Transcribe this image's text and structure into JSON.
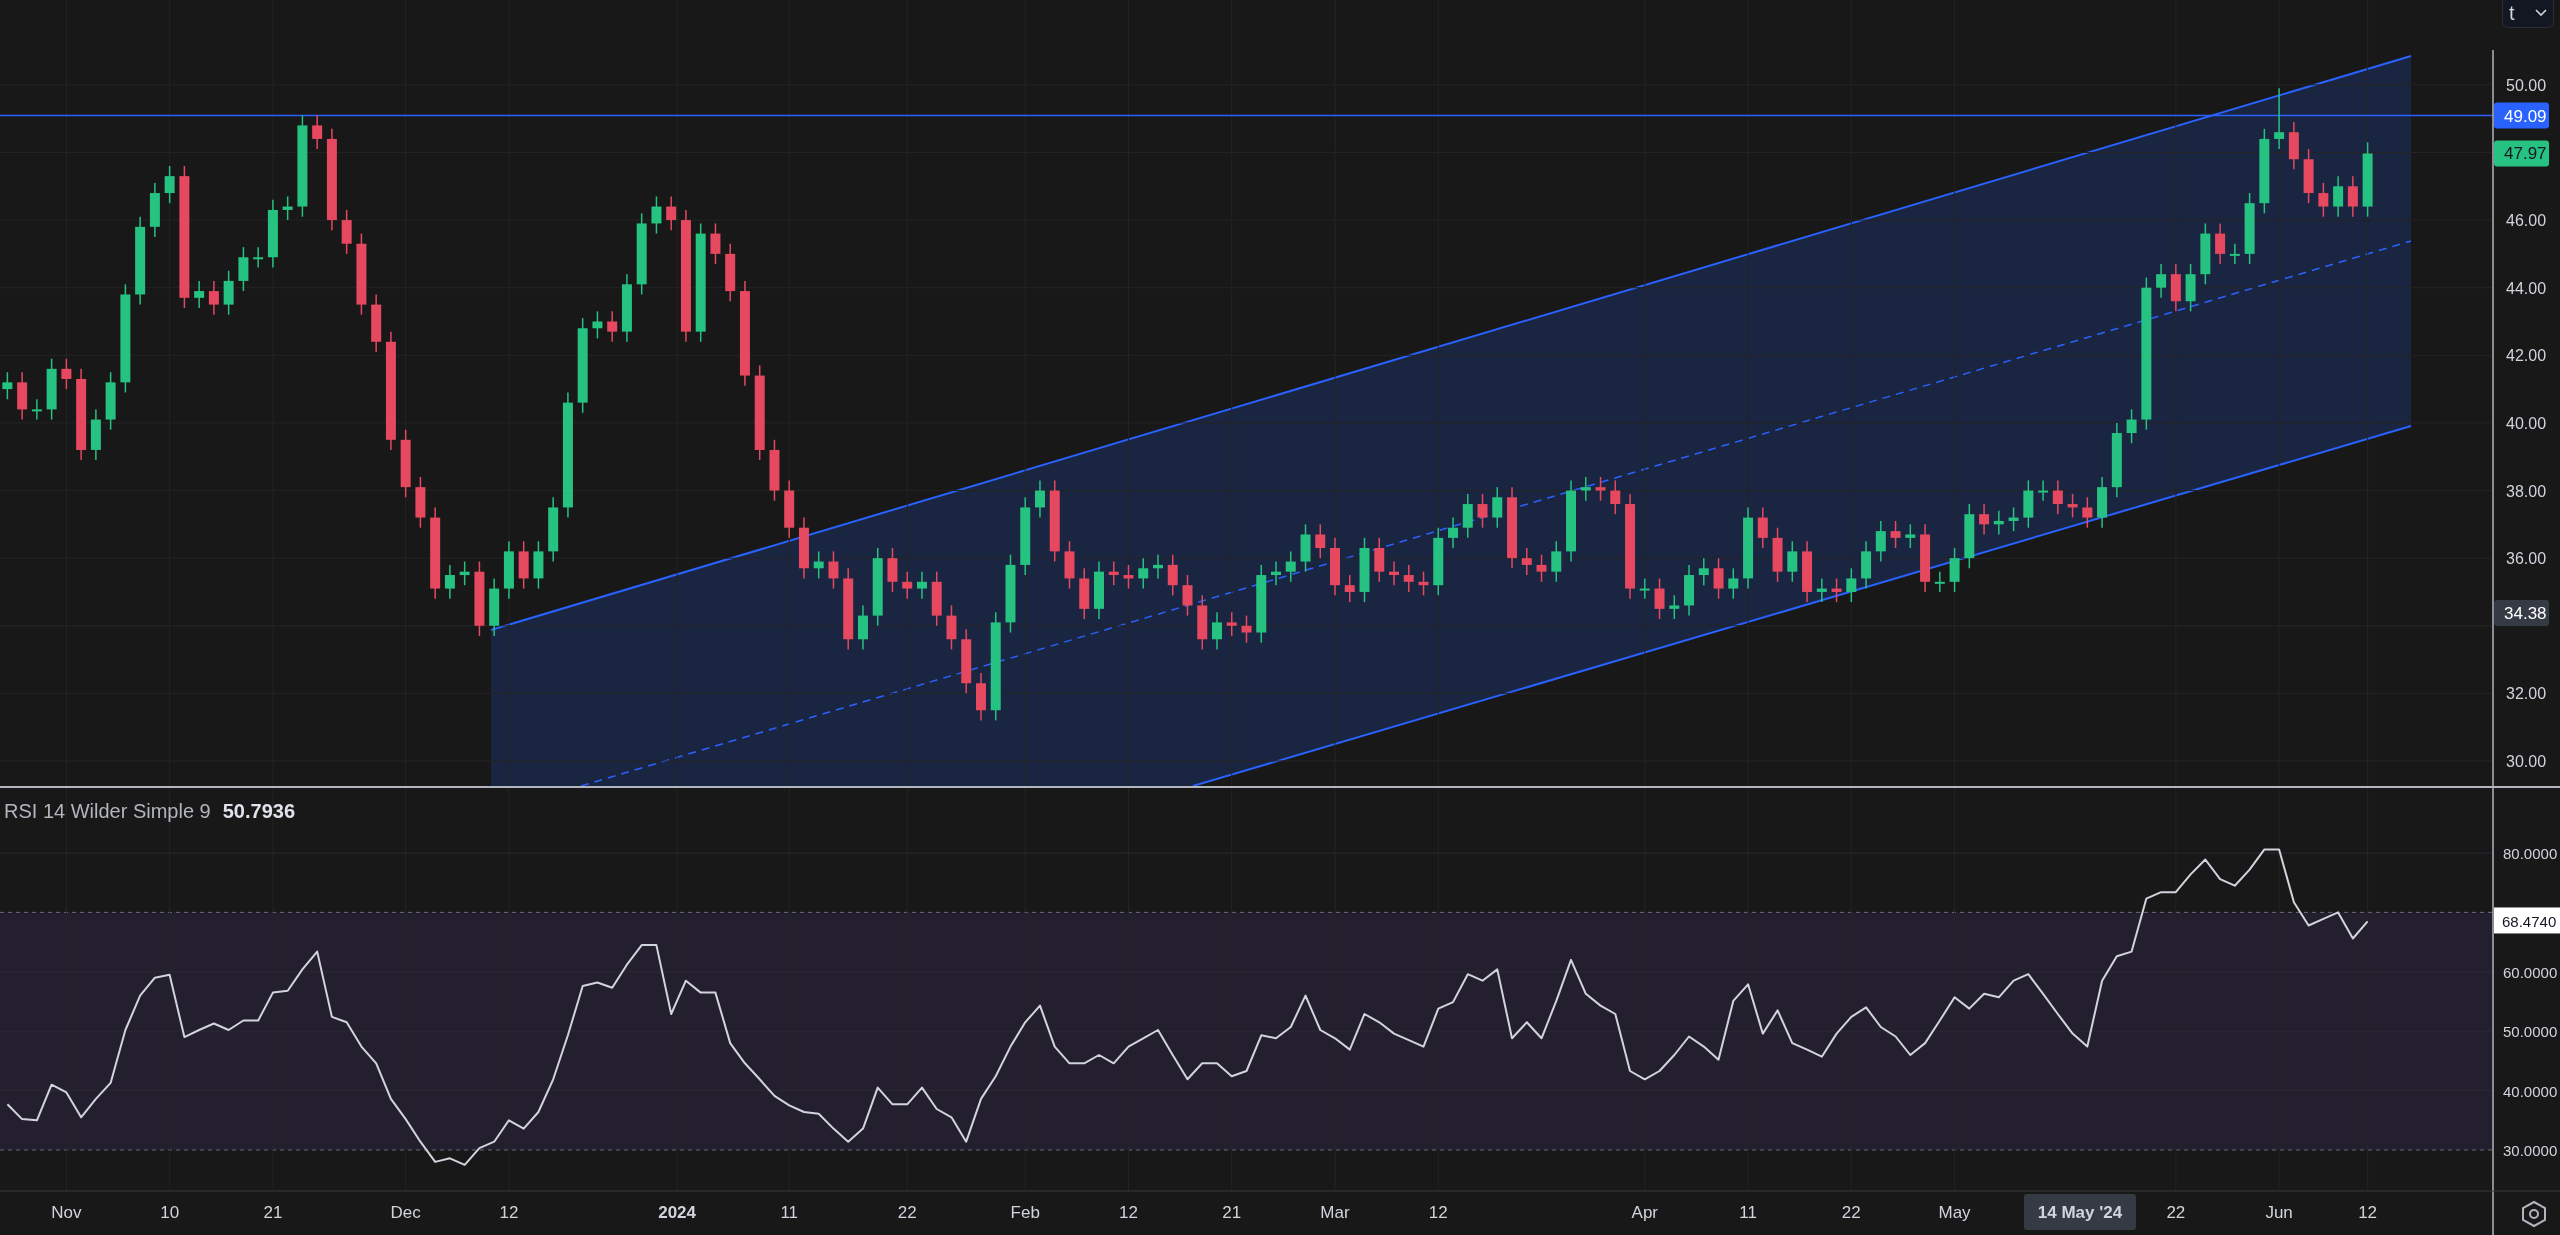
{
  "top_toolbar": {
    "dropdown": {
      "value": "t"
    }
  },
  "price_chart": {
    "chart_data": {
      "type": "candlestick",
      "grid": true,
      "ylim": [
        29.26,
        52.51
      ],
      "categories": [
        null,
        null,
        null,
        null,
        null,
        null,
        null,
        null,
        null,
        null,
        null,
        null,
        null,
        null,
        null,
        null,
        null,
        null,
        null,
        null,
        null,
        null,
        null,
        null,
        null,
        null,
        null,
        null,
        null,
        null,
        null,
        null,
        null,
        null,
        null,
        null,
        null,
        null,
        null,
        null,
        null,
        null,
        null,
        null,
        null,
        null,
        null,
        null,
        null,
        null,
        null,
        null,
        null,
        null,
        null,
        null,
        null,
        null,
        null,
        null,
        null,
        null,
        null,
        null,
        null,
        null,
        null,
        null,
        null,
        null,
        null,
        null,
        null,
        null,
        null,
        null,
        null,
        null,
        null,
        null,
        null,
        null,
        null,
        null,
        null,
        null,
        null,
        null,
        null,
        null,
        null,
        null,
        null,
        null,
        null,
        null,
        null,
        null,
        null,
        null,
        null,
        null,
        null,
        null,
        null,
        null,
        null,
        null,
        null,
        null,
        null,
        null,
        null,
        null,
        null,
        null,
        null,
        null,
        null,
        null,
        null,
        null,
        null,
        null,
        null,
        null,
        null,
        null,
        null,
        null,
        null,
        null,
        null,
        null,
        null,
        null,
        null,
        null,
        null,
        null,
        null,
        null,
        null,
        null,
        null,
        null,
        null,
        null,
        null,
        null,
        null,
        null,
        null,
        null,
        null,
        null,
        null,
        null,
        null,
        null,
        null,
        null,
        null,
        null,
        null,
        null,
        null,
        null,
        null
      ],
      "yticks": [
        {
          "value": 30,
          "label": "30.00"
        },
        {
          "value": 32,
          "label": "32.00"
        },
        {
          "value": 36,
          "label": "36.00"
        },
        {
          "value": 38,
          "label": "38.00"
        },
        {
          "value": 40,
          "label": "40.00"
        },
        {
          "value": 42,
          "label": "42.00"
        },
        {
          "value": 44,
          "label": "44.00"
        },
        {
          "value": 46,
          "label": "46.00"
        },
        {
          "value": 50,
          "label": "50.00"
        }
      ],
      "ohlc": [
        [
          41.0,
          41.5,
          40.7,
          41.2
        ],
        [
          41.2,
          41.5,
          40.1,
          40.4
        ],
        [
          40.4,
          40.7,
          40.1,
          40.4
        ],
        [
          40.4,
          41.9,
          40.1,
          41.6
        ],
        [
          41.6,
          41.9,
          41.0,
          41.3
        ],
        [
          41.3,
          41.6,
          38.9,
          39.2
        ],
        [
          39.2,
          40.4,
          38.9,
          40.1
        ],
        [
          40.1,
          41.5,
          39.8,
          41.2
        ],
        [
          41.2,
          44.1,
          40.9,
          43.8
        ],
        [
          43.8,
          46.1,
          43.5,
          45.8
        ],
        [
          45.8,
          47.1,
          45.5,
          46.8
        ],
        [
          46.8,
          47.6,
          46.5,
          47.3
        ],
        [
          47.3,
          47.6,
          43.4,
          43.7
        ],
        [
          43.7,
          44.2,
          43.4,
          43.9
        ],
        [
          43.9,
          44.2,
          43.2,
          43.5
        ],
        [
          43.5,
          44.5,
          43.2,
          44.2
        ],
        [
          44.2,
          45.2,
          43.9,
          44.9
        ],
        [
          44.9,
          45.2,
          44.6,
          44.9
        ],
        [
          44.9,
          46.6,
          44.6,
          46.3
        ],
        [
          46.3,
          46.7,
          46.0,
          46.4
        ],
        [
          46.4,
          49.1,
          46.1,
          48.8
        ],
        [
          48.8,
          49.1,
          48.1,
          48.4
        ],
        [
          48.4,
          48.7,
          45.7,
          46.0
        ],
        [
          46.0,
          46.3,
          45.0,
          45.3
        ],
        [
          45.3,
          45.6,
          43.2,
          43.5
        ],
        [
          43.5,
          43.8,
          42.1,
          42.4
        ],
        [
          42.4,
          42.7,
          39.2,
          39.5
        ],
        [
          39.5,
          39.8,
          37.8,
          38.1
        ],
        [
          38.1,
          38.4,
          36.9,
          37.2
        ],
        [
          37.2,
          37.5,
          34.8,
          35.1
        ],
        [
          35.1,
          35.8,
          34.8,
          35.5
        ],
        [
          35.5,
          35.9,
          35.2,
          35.6
        ],
        [
          35.6,
          35.9,
          33.7,
          34.0
        ],
        [
          34.0,
          35.4,
          33.7,
          35.1
        ],
        [
          35.1,
          36.5,
          34.8,
          36.2
        ],
        [
          36.2,
          36.5,
          35.1,
          35.4
        ],
        [
          35.4,
          36.5,
          35.1,
          36.2
        ],
        [
          36.2,
          37.8,
          35.9,
          37.5
        ],
        [
          37.5,
          40.9,
          37.2,
          40.6
        ],
        [
          40.6,
          43.1,
          40.3,
          42.8
        ],
        [
          42.8,
          43.3,
          42.5,
          43.0
        ],
        [
          43.0,
          43.3,
          42.4,
          42.7
        ],
        [
          42.7,
          44.4,
          42.4,
          44.1
        ],
        [
          44.1,
          46.2,
          43.8,
          45.9
        ],
        [
          45.9,
          46.7,
          45.6,
          46.4
        ],
        [
          46.4,
          46.7,
          45.7,
          46.0
        ],
        [
          46.0,
          46.3,
          42.4,
          42.7
        ],
        [
          42.7,
          45.9,
          42.4,
          45.6
        ],
        [
          45.6,
          45.9,
          44.7,
          45.0
        ],
        [
          45.0,
          45.3,
          43.6,
          43.9
        ],
        [
          43.9,
          44.2,
          41.1,
          41.4
        ],
        [
          41.4,
          41.7,
          38.9,
          39.2
        ],
        [
          39.2,
          39.5,
          37.7,
          38.0
        ],
        [
          38.0,
          38.3,
          36.6,
          36.9
        ],
        [
          36.9,
          37.2,
          35.4,
          35.7
        ],
        [
          35.7,
          36.2,
          35.4,
          35.9
        ],
        [
          35.9,
          36.2,
          35.1,
          35.4
        ],
        [
          35.4,
          35.7,
          33.3,
          33.6
        ],
        [
          33.6,
          34.6,
          33.3,
          34.3
        ],
        [
          34.3,
          36.3,
          34.0,
          36.0
        ],
        [
          36.0,
          36.3,
          35.0,
          35.3
        ],
        [
          35.3,
          35.6,
          34.8,
          35.1
        ],
        [
          35.1,
          35.6,
          34.8,
          35.3
        ],
        [
          35.3,
          35.6,
          34.0,
          34.3
        ],
        [
          34.3,
          34.6,
          33.3,
          33.6
        ],
        [
          33.6,
          33.9,
          32.0,
          32.3
        ],
        [
          32.3,
          32.6,
          31.2,
          31.5
        ],
        [
          31.5,
          34.4,
          31.2,
          34.1
        ],
        [
          34.1,
          36.1,
          33.8,
          35.8
        ],
        [
          35.8,
          37.8,
          35.5,
          37.5
        ],
        [
          37.5,
          38.3,
          37.2,
          38.0
        ],
        [
          38.0,
          38.3,
          35.9,
          36.2
        ],
        [
          36.2,
          36.5,
          35.1,
          35.4
        ],
        [
          35.4,
          35.7,
          34.2,
          34.5
        ],
        [
          34.5,
          35.9,
          34.2,
          35.6
        ],
        [
          35.6,
          35.9,
          35.2,
          35.5
        ],
        [
          35.5,
          35.8,
          35.1,
          35.4
        ],
        [
          35.4,
          36.0,
          35.1,
          35.7
        ],
        [
          35.7,
          36.1,
          35.4,
          35.8
        ],
        [
          35.8,
          36.1,
          34.9,
          35.2
        ],
        [
          35.2,
          35.5,
          34.3,
          34.6
        ],
        [
          34.6,
          34.9,
          33.3,
          33.6
        ],
        [
          33.6,
          34.4,
          33.3,
          34.1
        ],
        [
          34.1,
          34.4,
          33.7,
          34.0
        ],
        [
          34.0,
          34.3,
          33.5,
          33.8
        ],
        [
          33.8,
          35.8,
          33.5,
          35.5
        ],
        [
          35.5,
          35.9,
          35.2,
          35.6
        ],
        [
          35.6,
          36.2,
          35.3,
          35.9
        ],
        [
          35.9,
          37.0,
          35.6,
          36.7
        ],
        [
          36.7,
          37.0,
          36.0,
          36.3
        ],
        [
          36.3,
          36.6,
          34.9,
          35.2
        ],
        [
          35.2,
          35.5,
          34.7,
          35.0
        ],
        [
          35.0,
          36.6,
          34.7,
          36.3
        ],
        [
          36.3,
          36.6,
          35.3,
          35.6
        ],
        [
          35.6,
          35.9,
          35.2,
          35.5
        ],
        [
          35.5,
          35.8,
          35.0,
          35.3
        ],
        [
          35.3,
          35.6,
          34.9,
          35.2
        ],
        [
          35.2,
          36.9,
          34.9,
          36.6
        ],
        [
          36.6,
          37.2,
          36.3,
          36.9
        ],
        [
          36.9,
          37.9,
          36.6,
          37.6
        ],
        [
          37.6,
          37.9,
          36.9,
          37.2
        ],
        [
          37.2,
          38.1,
          36.9,
          37.8
        ],
        [
          37.8,
          38.1,
          35.7,
          36.0
        ],
        [
          36.0,
          36.3,
          35.5,
          35.8
        ],
        [
          35.8,
          36.1,
          35.3,
          35.6
        ],
        [
          35.6,
          36.5,
          35.3,
          36.2
        ],
        [
          36.2,
          38.3,
          35.9,
          38.0
        ],
        [
          38.0,
          38.4,
          37.7,
          38.1
        ],
        [
          38.1,
          38.4,
          37.7,
          38.0
        ],
        [
          38.0,
          38.3,
          37.3,
          37.6
        ],
        [
          37.6,
          37.9,
          34.8,
          35.1
        ],
        [
          35.1,
          35.4,
          34.8,
          35.1
        ],
        [
          35.1,
          35.4,
          34.2,
          34.5
        ],
        [
          34.5,
          34.9,
          34.2,
          34.6
        ],
        [
          34.6,
          35.8,
          34.3,
          35.5
        ],
        [
          35.5,
          36.0,
          35.2,
          35.7
        ],
        [
          35.7,
          36.0,
          34.8,
          35.1
        ],
        [
          35.1,
          35.7,
          34.8,
          35.4
        ],
        [
          35.4,
          37.5,
          35.1,
          37.2
        ],
        [
          37.2,
          37.5,
          36.3,
          36.6
        ],
        [
          36.6,
          36.9,
          35.3,
          35.6
        ],
        [
          35.6,
          36.5,
          35.3,
          36.2
        ],
        [
          36.2,
          36.5,
          34.7,
          35.0
        ],
        [
          35.0,
          35.4,
          34.7,
          35.1
        ],
        [
          35.1,
          35.4,
          34.7,
          35.0
        ],
        [
          35.0,
          35.7,
          34.7,
          35.4
        ],
        [
          35.4,
          36.5,
          35.1,
          36.2
        ],
        [
          36.2,
          37.1,
          35.9,
          36.8
        ],
        [
          36.8,
          37.1,
          36.3,
          36.6
        ],
        [
          36.6,
          37.0,
          36.3,
          36.7
        ],
        [
          36.7,
          37.0,
          35.0,
          35.3
        ],
        [
          35.3,
          35.6,
          35.0,
          35.3
        ],
        [
          35.3,
          36.3,
          35.0,
          36.0
        ],
        [
          36.0,
          37.6,
          35.7,
          37.3
        ],
        [
          37.3,
          37.6,
          36.7,
          37.0
        ],
        [
          37.0,
          37.4,
          36.7,
          37.1
        ],
        [
          37.1,
          37.5,
          36.8,
          37.2
        ],
        [
          37.2,
          38.3,
          36.9,
          38.0
        ],
        [
          38.0,
          38.3,
          37.7,
          38.0
        ],
        [
          38.0,
          38.3,
          37.3,
          37.6
        ],
        [
          37.6,
          37.9,
          37.2,
          37.5
        ],
        [
          37.5,
          37.8,
          36.9,
          37.2
        ],
        [
          37.2,
          38.4,
          36.9,
          38.1
        ],
        [
          38.1,
          40.0,
          37.8,
          39.7
        ],
        [
          39.7,
          40.4,
          39.4,
          40.1
        ],
        [
          40.1,
          44.3,
          39.8,
          44.0
        ],
        [
          44.0,
          44.7,
          43.7,
          44.4
        ],
        [
          44.4,
          44.7,
          43.3,
          43.6
        ],
        [
          43.6,
          44.7,
          43.3,
          44.4
        ],
        [
          44.4,
          45.9,
          44.1,
          45.6
        ],
        [
          45.6,
          45.9,
          44.7,
          45.0
        ],
        [
          45.0,
          45.3,
          44.7,
          45.0
        ],
        [
          45.0,
          46.8,
          44.7,
          46.5
        ],
        [
          46.5,
          48.7,
          46.2,
          48.4
        ],
        [
          48.4,
          49.9,
          48.1,
          48.6
        ],
        [
          48.6,
          48.9,
          47.5,
          47.8
        ],
        [
          47.8,
          48.1,
          46.5,
          46.8
        ],
        [
          46.8,
          47.1,
          46.1,
          46.4
        ],
        [
          46.4,
          47.3,
          46.1,
          47.0
        ],
        [
          47.0,
          47.3,
          46.1,
          46.4
        ],
        [
          46.4,
          48.3,
          46.1,
          47.97
        ],
        null,
        null,
        null,
        null,
        null,
        null,
        null,
        null
      ],
      "ref_lines": [
        {
          "axis": "y",
          "value": 49.09
        }
      ]
    },
    "price_labels": [
      {
        "text": "49.09",
        "color": "#2962ff"
      },
      {
        "text": "47.97",
        "color": "#26c281"
      },
      {
        "text": "34.38",
        "color": "#363a45"
      }
    ]
  },
  "rsi_panel": {
    "legend": {
      "name": "RSI 14 Wilder Simple 9",
      "value": "50.7936"
    },
    "last_value": "68.4740",
    "chart_data": {
      "type": "line",
      "grid": true,
      "ylim": [
        15.69,
        90.94
      ],
      "yticks": [
        {
          "value": 30,
          "label": "30.0000"
        },
        {
          "value": 40,
          "label": "40.0000"
        },
        {
          "value": 50,
          "label": "50.0000"
        },
        {
          "value": 60,
          "label": "60.0000"
        },
        {
          "value": 80,
          "label": "80.0000"
        }
      ],
      "categories": [
        null,
        null,
        null,
        null,
        "Nov",
        null,
        null,
        null,
        null,
        null,
        null,
        "10",
        null,
        null,
        null,
        null,
        null,
        null,
        "21",
        null,
        null,
        null,
        null,
        null,
        null,
        null,
        null,
        "Dec",
        null,
        null,
        null,
        null,
        null,
        null,
        "12",
        null,
        null,
        null,
        null,
        null,
        null,
        null,
        null,
        null,
        null,
        null,
        null,
        null,
        null,
        null,
        null,
        null,
        null,
        "11",
        null,
        null,
        null,
        null,
        null,
        null,
        null,
        "22",
        null,
        null,
        null,
        null,
        null,
        null,
        null,
        "Feb",
        null,
        null,
        null,
        null,
        null,
        null,
        "12",
        null,
        null,
        null,
        null,
        null,
        null,
        "21",
        null,
        null,
        null,
        null,
        null,
        null,
        "Mar",
        null,
        null,
        null,
        null,
        null,
        null,
        "12",
        null,
        null,
        null,
        null,
        null,
        null,
        null,
        null,
        null,
        null,
        null,
        null,
        null,
        "Apr",
        null,
        null,
        null,
        null,
        null,
        null,
        "11",
        null,
        null,
        null,
        null,
        null,
        null,
        "22",
        null,
        null,
        null,
        null,
        null,
        null,
        "May",
        null,
        null,
        null,
        null,
        null,
        null,
        null,
        null,
        null,
        null,
        null,
        null,
        null,
        null,
        "22",
        null,
        null,
        null,
        null,
        null,
        null,
        "Jun",
        null,
        null,
        null,
        null,
        null,
        "12",
        null,
        null,
        null,
        null,
        null,
        null,
        null,
        null
      ],
      "ref_lines": [
        {
          "axis": "y",
          "value": 70
        },
        {
          "axis": "y",
          "value": 30
        }
      ],
      "series": [
        {
          "color": "#d1d4dc",
          "values": [
            37.7,
            35.2,
            35,
            41,
            39.7,
            35.5,
            38.6,
            41.3,
            50.2,
            56,
            59,
            59.5,
            49,
            50.2,
            51.3,
            50.2,
            51.8,
            51.8,
            56.5,
            56.8,
            60.4,
            63.4,
            52.4,
            51.5,
            47.4,
            44.6,
            38.6,
            35.2,
            31.4,
            28,
            28.6,
            27.5,
            30.3,
            31.4,
            35,
            33.6,
            36.4,
            41.9,
            49.3,
            57.6,
            58.2,
            57.3,
            61.2,
            64.5,
            64.5,
            52.9,
            58.5,
            56.5,
            56.5,
            48,
            44.6,
            41.9,
            39.1,
            37.5,
            36.4,
            36.1,
            33.6,
            31.4,
            33.6,
            40.5,
            37.7,
            37.7,
            40.5,
            36.9,
            35.5,
            31.4,
            38.6,
            42.4,
            47.4,
            51.5,
            54.3,
            47.4,
            44.6,
            44.6,
            46,
            44.6,
            47.4,
            48.8,
            50.2,
            46,
            41.9,
            44.6,
            44.6,
            42.4,
            43.3,
            49.3,
            48.8,
            50.7,
            56,
            50.2,
            48.8,
            46.9,
            52.9,
            51.5,
            49.6,
            48.5,
            47.4,
            53.8,
            54.9,
            59.6,
            58.5,
            60.4,
            48.8,
            51.5,
            48.8,
            55.1,
            62,
            56.3,
            54.3,
            52.9,
            43.3,
            41.9,
            43.3,
            46,
            49.1,
            47.4,
            45.2,
            55.1,
            57.9,
            49.6,
            53.5,
            48,
            46.9,
            45.7,
            49.6,
            52.4,
            54,
            50.7,
            49.1,
            46,
            48,
            51.8,
            55.7,
            53.8,
            56.3,
            55.7,
            58.5,
            59.6,
            56.3,
            52.9,
            49.6,
            47.4,
            58.5,
            62.6,
            63.4,
            72.3,
            73.4,
            73.4,
            76.4,
            78.9,
            75.6,
            74.5,
            77.2,
            80.6,
            80.6,
            71.7,
            67.8,
            68.9,
            70,
            65.6,
            68.5,
            null,
            null,
            null,
            null,
            null,
            null,
            null,
            null
          ]
        }
      ]
    }
  },
  "time_axis": {
    "year_label": {
      "text": "2024",
      "bold": true
    },
    "crosshair_label": "14 May '24"
  }
}
